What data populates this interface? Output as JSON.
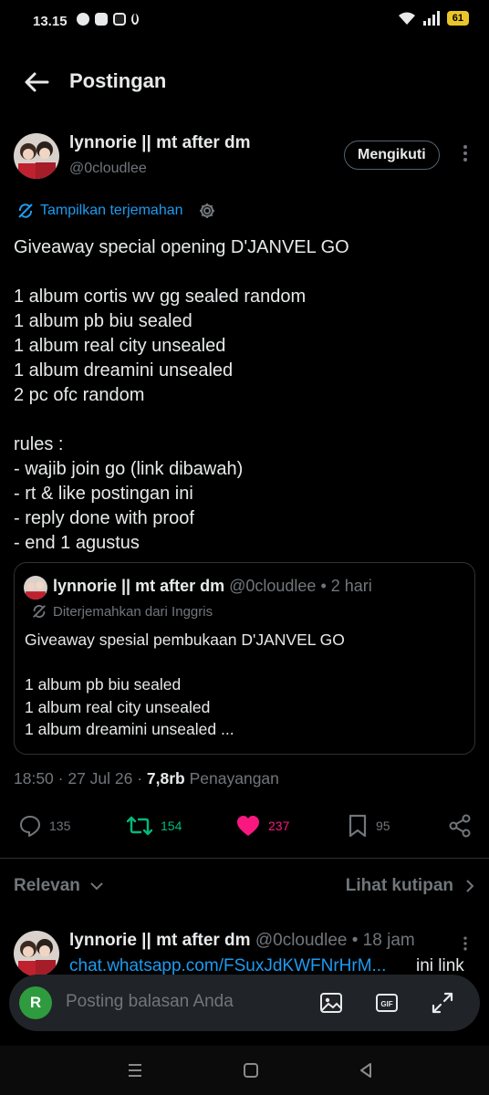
{
  "status_bar": {
    "time": "13.15",
    "battery": "61"
  },
  "header": {
    "title": "Postingan"
  },
  "post": {
    "author_name": "lynnorie || mt after dm",
    "author_handle": "@0cloudlee",
    "follow_label": "Mengikuti",
    "translate_label": "Tampilkan terjemahan",
    "text": "Giveaway special opening D'JANVEL GO\n\n1 album cortis wv gg sealed random\n1 album pb biu sealed\n1 album real city unsealed\n1 album dreamini unsealed\n2 pc ofc random\n\nrules :\n- wajib join go (link dibawah)\n- rt & like postingan ini\n- reply done with proof\n- end 1 agustus",
    "meta_time": "18:50 · 27 Jul 26 · ",
    "meta_views": "7,8rb",
    "meta_views_label": " Penayangan"
  },
  "quote": {
    "author_name": "lynnorie || mt after dm",
    "meta": " @0cloudlee • 2 hari",
    "translated_label": "Diterjemahkan dari Inggris",
    "text": "Giveaway spesial pembukaan D'JANVEL GO\n\n1 album pb biu sealed\n1 album real city unsealed\n1 album dreamini unsealed ..."
  },
  "actions": {
    "replies": "135",
    "reposts": "154",
    "likes": "237",
    "bookmarks": "95"
  },
  "sort": {
    "left_label": "Relevan",
    "right_label": "Lihat kutipan"
  },
  "reply": {
    "author_name": "lynnorie || mt after dm",
    "meta": " @0cloudlee • 18 jam",
    "link_text": "chat.whatsapp.com/FSuxJdKWFNrHrM...",
    "link_suffix": "ini link"
  },
  "composer": {
    "avatar_letter": "R",
    "placeholder": "Posting balasan Anda"
  },
  "colors": {
    "accent": "#1d9bf0",
    "repost": "#00ba7c",
    "like": "#f91880",
    "muted": "#71767b"
  },
  "icons": [
    "back-arrow-icon",
    "more-icon",
    "translate-icon",
    "gear-icon",
    "reply-icon",
    "repost-icon",
    "heart-icon",
    "bookmark-icon",
    "share-icon",
    "chevron-down-icon",
    "chevron-right-icon",
    "image-icon",
    "gif-icon",
    "expand-icon"
  ]
}
